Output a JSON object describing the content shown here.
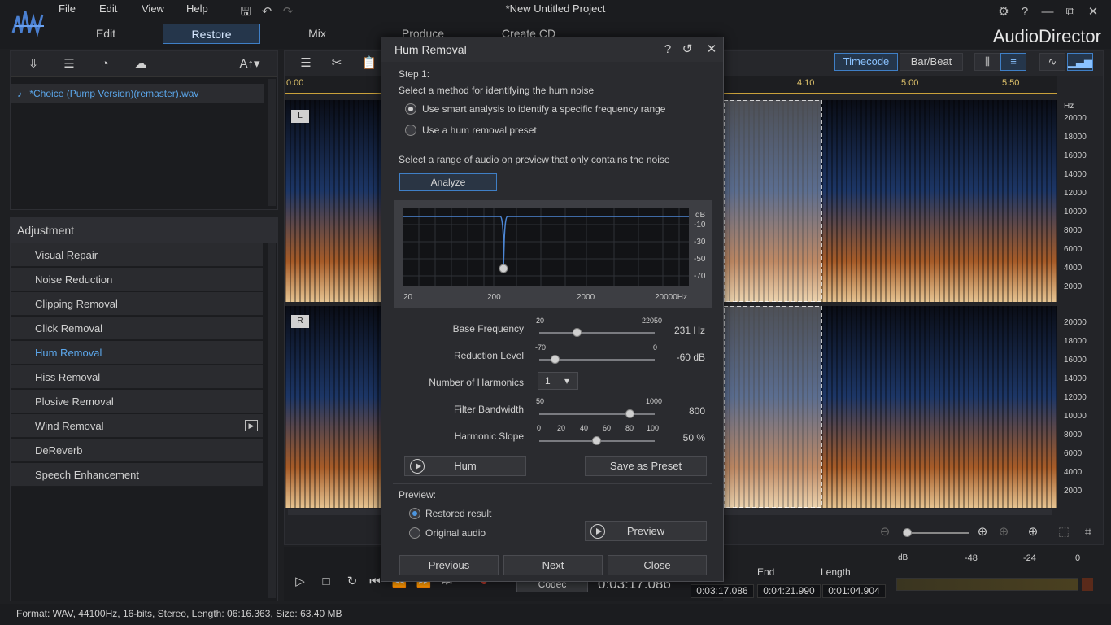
{
  "menu": [
    "File",
    "Edit",
    "View",
    "Help"
  ],
  "window_title": "*New Untitled Project",
  "tabs": [
    "Edit",
    "Restore",
    "Mix",
    "Produce",
    "Create CD"
  ],
  "active_tab": "Restore",
  "brand": "AudioDirector",
  "left_toolbar": {
    "text_tool": "A↑▾"
  },
  "media": {
    "file": "*Choice (Pump Version)(remaster).wav"
  },
  "adjustment": {
    "header": "Adjustment",
    "items": [
      "Visual Repair",
      "Noise Reduction",
      "Clipping Removal",
      "Click Removal",
      "Hum Removal",
      "Hiss Removal",
      "Plosive Removal",
      "Wind Removal",
      "DeReverb",
      "Speech Enhancement"
    ],
    "active": "Hum Removal"
  },
  "status": "Format: WAV, 44100Hz, 16-bits, Stereo, Length: 06:16.363, Size: 63.40 MB",
  "editor": {
    "timecode_label": "Timecode",
    "barbeat_label": "Bar/Beat",
    "ruler": [
      "0:00",
      "4:10",
      "5:00",
      "5:50"
    ],
    "hz_unit": "Hz",
    "hz_ticks": [
      "20000",
      "18000",
      "16000",
      "14000",
      "12000",
      "10000",
      "8000",
      "6000",
      "4000",
      "2000"
    ],
    "left_label": "L",
    "right_label": "R"
  },
  "transport": {
    "codec": "Codec",
    "time": "0:03:17.086"
  },
  "times": {
    "end_label": "End",
    "length_label": "Length",
    "start": "0:03:17.086",
    "end": "0:04:21.990",
    "length": "0:01:04.904"
  },
  "meter": {
    "labels": [
      "dB",
      "-48",
      "-24",
      "0"
    ]
  },
  "dialog": {
    "title": "Hum Removal",
    "step": "Step 1:",
    "method_prompt": "Select a method for identifying the hum noise",
    "option_smart": "Use smart analysis to identify a specific frequency range",
    "option_preset": "Use a hum removal preset",
    "range_prompt": "Select a range of audio on preview that only contains the noise",
    "analyze": "Analyze",
    "graph": {
      "db_unit": "dB",
      "db_ticks": [
        "-10",
        "-30",
        "-50",
        "-70"
      ],
      "freq_ticks": [
        "20",
        "200",
        "2000",
        "20000Hz"
      ]
    },
    "base_frequency": {
      "label": "Base Frequency",
      "min": "20",
      "max": "22050",
      "value": "231 Hz",
      "level": 0.33
    },
    "reduction_level": {
      "label": "Reduction Level",
      "min": "-70",
      "max": "0",
      "value": "-60 dB",
      "level": 0.14
    },
    "harmonics": {
      "label": "Number of Harmonics",
      "value": "1"
    },
    "filter_bandwidth": {
      "label": "Filter Bandwidth",
      "min": "50",
      "max": "1000",
      "value": "800",
      "level": 0.79
    },
    "harmonic_slope": {
      "label": "Harmonic Slope",
      "ticks": [
        "0",
        "20",
        "40",
        "60",
        "80",
        "100"
      ],
      "value": "50 %",
      "level": 0.5
    },
    "hum_button": "Hum",
    "save_preset": "Save as Preset",
    "preview_label": "Preview:",
    "restored": "Restored result",
    "original": "Original audio",
    "preview_button": "Preview",
    "previous": "Previous",
    "next": "Next",
    "close": "Close"
  }
}
